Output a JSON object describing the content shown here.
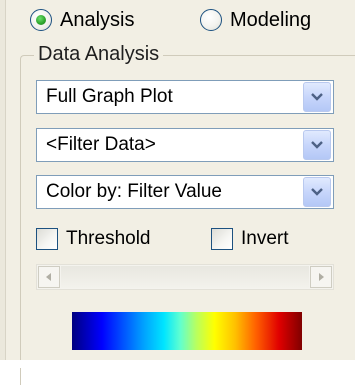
{
  "mode_radios": [
    {
      "label": "Analysis",
      "checked": true
    },
    {
      "label": "Modeling",
      "checked": false
    }
  ],
  "group": {
    "title": "Data Analysis"
  },
  "dropdowns": [
    {
      "value": "Full Graph Plot"
    },
    {
      "value": "<Filter Data>"
    },
    {
      "value": "Color by: Filter Value"
    }
  ],
  "checkboxes": [
    {
      "label": "Threshold",
      "checked": false
    },
    {
      "label": "Invert",
      "checked": false
    }
  ],
  "colors": {
    "accent": "#1c5180",
    "panel_bg": "#f2efe4",
    "colormap": [
      "#000080",
      "#0000ff",
      "#00e5ff",
      "#ffff00",
      "#e00000",
      "#800000"
    ]
  },
  "icons": {
    "dropdown_arrow": "chevron-down-icon",
    "scroll_left": "arrow-left-icon",
    "scroll_right": "arrow-right-icon"
  }
}
